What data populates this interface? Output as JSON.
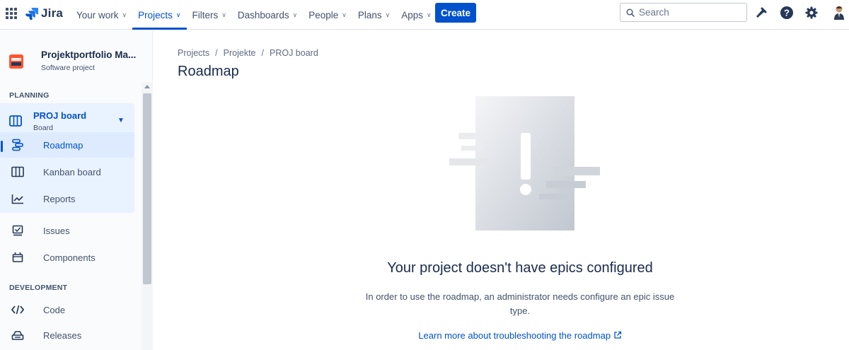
{
  "topnav": {
    "logo_text": "Jira",
    "items": [
      {
        "label": "Your work",
        "active": false
      },
      {
        "label": "Projects",
        "active": true
      },
      {
        "label": "Filters",
        "active": false
      },
      {
        "label": "Dashboards",
        "active": false
      },
      {
        "label": "People",
        "active": false
      },
      {
        "label": "Plans",
        "active": false
      },
      {
        "label": "Apps",
        "active": false
      }
    ],
    "create_label": "Create",
    "search_placeholder": "Search",
    "brand_color": "#0052cc"
  },
  "sidebar": {
    "project_name": "Projektportfolio Ma...",
    "project_type": "Software project",
    "planning_label": "PLANNING",
    "board_name": "PROJ board",
    "board_sub": "Board",
    "planning_items": [
      {
        "label": "Roadmap",
        "icon": "roadmap-icon",
        "selected": true
      },
      {
        "label": "Kanban board",
        "icon": "kanban-icon",
        "selected": false
      },
      {
        "label": "Reports",
        "icon": "reports-icon",
        "selected": false
      }
    ],
    "other_items": [
      {
        "label": "Issues",
        "icon": "issues-icon"
      },
      {
        "label": "Components",
        "icon": "components-icon"
      }
    ],
    "development_label": "DEVELOPMENT",
    "dev_items": [
      {
        "label": "Code",
        "icon": "code-icon"
      },
      {
        "label": "Releases",
        "icon": "releases-icon"
      }
    ]
  },
  "main": {
    "breadcrumb": [
      "Projects",
      "Projekte",
      "PROJ board"
    ],
    "title": "Roadmap",
    "empty_title": "Your project doesn't have epics configured",
    "empty_desc": "In order to use the roadmap, an administrator needs configure an epic issue type.",
    "learn_link": "Learn more about troubleshooting the roadmap"
  }
}
